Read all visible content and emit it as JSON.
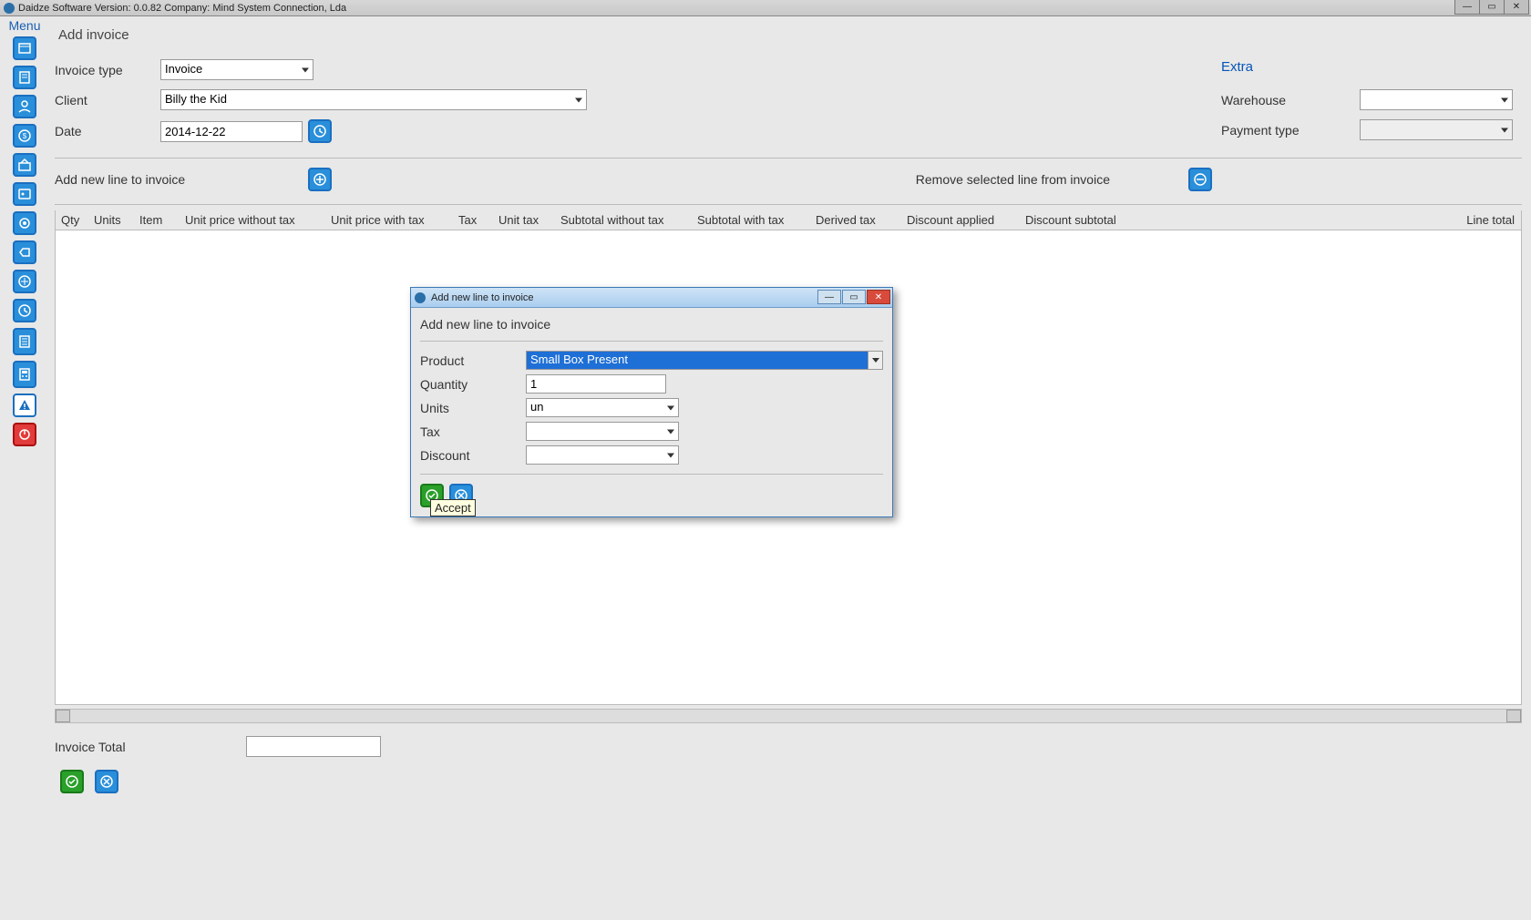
{
  "titlebar": "Daidze Software Version: 0.0.82 Company: Mind System Connection, Lda",
  "menu_label": "Menu",
  "page_title": "Add invoice",
  "form": {
    "invoice_type_label": "Invoice type",
    "invoice_type_value": "Invoice",
    "client_label": "Client",
    "client_value": "Billy the Kid",
    "date_label": "Date",
    "date_value": "2014-12-22"
  },
  "extra": {
    "title": "Extra",
    "warehouse_label": "Warehouse",
    "warehouse_value": "",
    "payment_label": "Payment type",
    "payment_value": ""
  },
  "line_actions": {
    "add_label": "Add new line to invoice",
    "remove_label": "Remove selected line from invoice"
  },
  "columns": {
    "qty": "Qty",
    "units": "Units",
    "item": "Item",
    "unit_price_no_tax": "Unit price without tax",
    "unit_price_tax": "Unit price with tax",
    "tax": "Tax",
    "unit_tax": "Unit tax",
    "subtotal_no_tax": "Subtotal without tax",
    "subtotal_tax": "Subtotal with tax",
    "derived_tax": "Derived tax",
    "discount_applied": "Discount applied",
    "discount_subtotal": "Discount subtotal",
    "line_total": "Line total"
  },
  "footer": {
    "total_label": "Invoice Total",
    "total_value": ""
  },
  "dialog": {
    "title": "Add new line to invoice",
    "section": "Add new line to invoice",
    "product_label": "Product",
    "product_value": "Small Box Present",
    "quantity_label": "Quantity",
    "quantity_value": "1",
    "units_label": "Units",
    "units_value": "un",
    "tax_label": "Tax",
    "tax_value": "",
    "discount_label": "Discount",
    "discount_value": ""
  },
  "tooltip": "Accept"
}
